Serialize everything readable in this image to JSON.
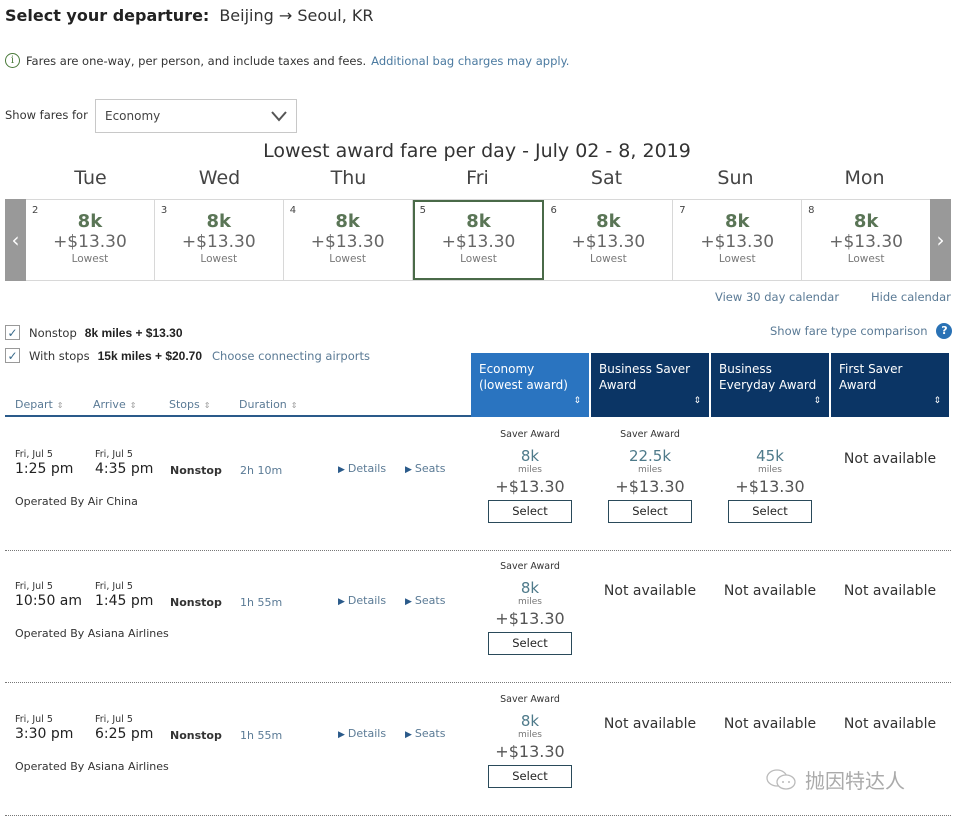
{
  "header": {
    "title_label": "Select your departure:",
    "route": "Beijing → Seoul, KR"
  },
  "info": {
    "text": "Fares are one-way, per person, and include taxes and fees.",
    "link": "Additional bag charges may apply."
  },
  "fare_filter": {
    "label": "Show fares for",
    "selected": "Economy"
  },
  "calendar": {
    "title": "Lowest award fare per day - July 02 - 8, 2019",
    "days": [
      {
        "name": "Tue",
        "date": "2",
        "miles": "8k",
        "price": "+$13.30",
        "note": "Lowest",
        "selected": false
      },
      {
        "name": "Wed",
        "date": "3",
        "miles": "8k",
        "price": "+$13.30",
        "note": "Lowest",
        "selected": false
      },
      {
        "name": "Thu",
        "date": "4",
        "miles": "8k",
        "price": "+$13.30",
        "note": "Lowest",
        "selected": false
      },
      {
        "name": "Fri",
        "date": "5",
        "miles": "8k",
        "price": "+$13.30",
        "note": "Lowest",
        "selected": true
      },
      {
        "name": "Sat",
        "date": "6",
        "miles": "8k",
        "price": "+$13.30",
        "note": "Lowest",
        "selected": false
      },
      {
        "name": "Sun",
        "date": "7",
        "miles": "8k",
        "price": "+$13.30",
        "note": "Lowest",
        "selected": false
      },
      {
        "name": "Mon",
        "date": "8",
        "miles": "8k",
        "price": "+$13.30",
        "note": "Lowest",
        "selected": false
      }
    ],
    "prev_icon": "chevron-left",
    "next_icon": "chevron-right",
    "view_30_link": "View 30 day calendar",
    "hide_link": "Hide calendar"
  },
  "filters": {
    "nonstop": {
      "label": "Nonstop",
      "summary": "8k miles + $13.30",
      "checked": true
    },
    "with_stops": {
      "label": "With stops",
      "summary": "15k miles + $20.70",
      "checked": true,
      "link": "Choose connecting airports"
    },
    "fare_compare_link": "Show fare type comparison",
    "help_icon": "?"
  },
  "table": {
    "columns": [
      "Depart",
      "Arrive",
      "Stops",
      "Duration"
    ],
    "fare_columns": [
      {
        "label": "Economy (lowest award)",
        "active": true
      },
      {
        "label": "Business Saver Award",
        "active": false
      },
      {
        "label": "Business Everyday Award",
        "active": false
      },
      {
        "label": "First Saver Award",
        "active": false
      }
    ],
    "details_label": "Details",
    "seats_label": "Seats",
    "select_label": "Select",
    "miles_label": "miles",
    "not_available": "Not available"
  },
  "flights": [
    {
      "depart_date": "Fri, Jul 5",
      "depart_time": "1:25 pm",
      "arrive_date": "Fri, Jul 5",
      "arrive_time": "4:35 pm",
      "stops": "Nonstop",
      "duration": "2h 10m",
      "operator": "Operated By Air China",
      "fares": [
        {
          "type": "Saver Award",
          "miles": "8k",
          "price": "+$13.30",
          "available": true
        },
        {
          "type": "Saver Award",
          "miles": "22.5k",
          "price": "+$13.30",
          "available": true
        },
        {
          "type": "",
          "miles": "45k",
          "price": "+$13.30",
          "available": true
        },
        {
          "available": false
        }
      ]
    },
    {
      "depart_date": "Fri, Jul 5",
      "depart_time": "10:50 am",
      "arrive_date": "Fri, Jul 5",
      "arrive_time": "1:45 pm",
      "stops": "Nonstop",
      "duration": "1h 55m",
      "operator": "Operated By Asiana Airlines",
      "fares": [
        {
          "type": "Saver Award",
          "miles": "8k",
          "price": "+$13.30",
          "available": true
        },
        {
          "available": false
        },
        {
          "available": false
        },
        {
          "available": false
        }
      ]
    },
    {
      "depart_date": "Fri, Jul 5",
      "depart_time": "3:30 pm",
      "arrive_date": "Fri, Jul 5",
      "arrive_time": "6:25 pm",
      "stops": "Nonstop",
      "duration": "1h 55m",
      "operator": "Operated By Asiana Airlines",
      "fares": [
        {
          "type": "Saver Award",
          "miles": "8k",
          "price": "+$13.30",
          "available": true
        },
        {
          "available": false
        },
        {
          "available": false
        },
        {
          "available": false
        }
      ]
    }
  ],
  "watermark": "抛因特达人",
  "colors": {
    "accent_blue": "#2a74c0",
    "dark_navy": "#0b3565",
    "calendar_green": "#5a7556",
    "link_blue": "#5a7a95"
  }
}
